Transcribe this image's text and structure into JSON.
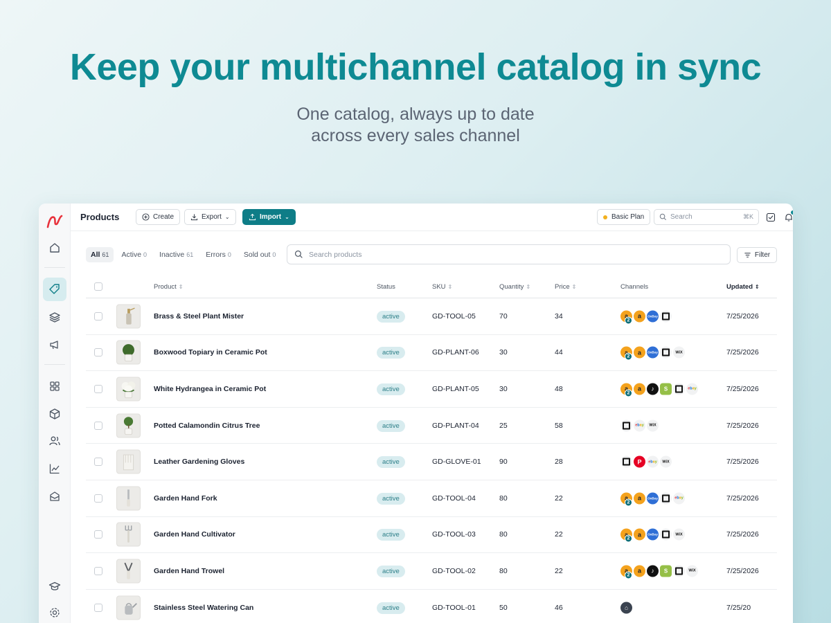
{
  "hero": {
    "title": "Keep your multichannel catalog in sync",
    "subtitle_line1": "One catalog, always up to date",
    "subtitle_line2": "across every sales channel"
  },
  "colors": {
    "accent": "#0e8a93",
    "primary_button": "#0e7d87",
    "status_bg": "#d8ecef",
    "plan_dot": "#f2b01e"
  },
  "sidebar": {
    "items": [
      {
        "icon": "home-icon"
      },
      {
        "icon": "tag-icon",
        "active": true
      },
      {
        "icon": "layers-icon"
      },
      {
        "icon": "megaphone-icon"
      },
      {
        "icon": "grid-icon"
      },
      {
        "icon": "box-icon"
      },
      {
        "icon": "users-icon"
      },
      {
        "icon": "chart-icon"
      },
      {
        "icon": "inbox-icon"
      },
      {
        "icon": "graduation-cap-icon"
      },
      {
        "icon": "settings-icon"
      }
    ]
  },
  "header": {
    "title": "Products",
    "create_label": "Create",
    "export_label": "Export",
    "import_label": "Import",
    "plan_label": "Basic Plan",
    "search_placeholder": "Search",
    "search_shortcut": "⌘K"
  },
  "filters": {
    "tabs": [
      {
        "label": "All",
        "count": "61",
        "active": true
      },
      {
        "label": "Active",
        "count": "0"
      },
      {
        "label": "Inactive",
        "count": "61"
      },
      {
        "label": "Errors",
        "count": "0"
      },
      {
        "label": "Sold out",
        "count": "0"
      }
    ],
    "search_placeholder": "Search products",
    "filter_label": "Filter"
  },
  "table": {
    "columns": {
      "product": "Product",
      "status": "Status",
      "sku": "SKU",
      "quantity": "Quantity",
      "price": "Price",
      "channels": "Channels",
      "updated": "Updated"
    },
    "rows": [
      {
        "name": "Brass & Steel Plant Mister",
        "status": "active",
        "sku": "GD-TOOL-05",
        "quantity": "70",
        "price": "34",
        "updated": "7/25/2026"
      },
      {
        "name": "Boxwood Topiary in Ceramic Pot",
        "status": "active",
        "sku": "GD-PLANT-06",
        "quantity": "30",
        "price": "44",
        "updated": "7/25/2026"
      },
      {
        "name": "White Hydrangea in Ceramic Pot",
        "status": "active",
        "sku": "GD-PLANT-05",
        "quantity": "30",
        "price": "48",
        "updated": "7/25/2026"
      },
      {
        "name": "Potted Calamondin Citrus Tree",
        "status": "active",
        "sku": "GD-PLANT-04",
        "quantity": "25",
        "price": "58",
        "updated": "7/25/2026"
      },
      {
        "name": "Leather Gardening Gloves",
        "status": "active",
        "sku": "GD-GLOVE-01",
        "quantity": "90",
        "price": "28",
        "updated": "7/25/2026"
      },
      {
        "name": "Garden Hand Fork",
        "status": "active",
        "sku": "GD-TOOL-04",
        "quantity": "80",
        "price": "22",
        "updated": "7/25/2026"
      },
      {
        "name": "Garden Hand Cultivator",
        "status": "active",
        "sku": "GD-TOOL-03",
        "quantity": "80",
        "price": "22",
        "updated": "7/25/2026"
      },
      {
        "name": "Garden Hand Trowel",
        "status": "active",
        "sku": "GD-TOOL-02",
        "quantity": "80",
        "price": "22",
        "updated": "7/25/2026"
      },
      {
        "name": "Stainless Steel Watering Can",
        "status": "active",
        "sku": "GD-TOOL-01",
        "quantity": "50",
        "price": "46",
        "updated": "7/25/20"
      }
    ],
    "channel_badge_amazon_count": "2",
    "channel_labels": {
      "onbuy": "OnBuy",
      "ebay": "ebay",
      "wix": "WiX"
    }
  }
}
